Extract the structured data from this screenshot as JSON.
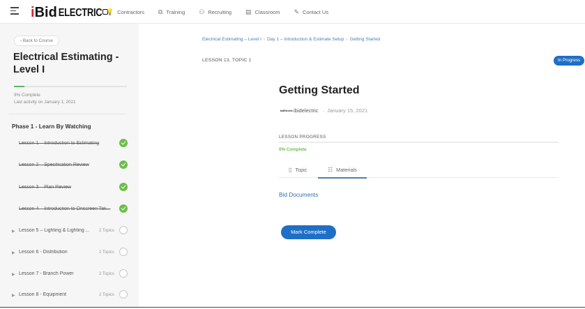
{
  "header": {
    "logo_word": "Bid",
    "logo_accent": "ELECTRIC",
    "nav": [
      {
        "label": "Contractors",
        "icon": "lightbulb-icon",
        "glyph": "💡"
      },
      {
        "label": "Training",
        "icon": "training-icon",
        "glyph": "⧉"
      },
      {
        "label": "Recruiting",
        "icon": "recruiting-icon",
        "glyph": "⚇"
      },
      {
        "label": "Classroom",
        "icon": "classroom-icon",
        "glyph": "▤"
      },
      {
        "label": "Contact Us",
        "icon": "edit-icon",
        "glyph": "✎"
      }
    ]
  },
  "sidebar": {
    "back_label": "‹  Back to Course",
    "course_title": "Electrical Estimating - Level I",
    "progress_pct": 0.09,
    "complete_text": "9% Complete",
    "activity_text": "Last activity on January 1, 2021",
    "phase_title": "Phase 1 - Learn By Watching",
    "lessons": [
      {
        "title": "Lesson 1 – Introduction to Estimating",
        "topics": "",
        "done": true
      },
      {
        "title": "Lesson 2 – Specification Review",
        "topics": "",
        "done": true
      },
      {
        "title": "Lesson 3 – Plan Review",
        "topics": "",
        "done": true
      },
      {
        "title": "Lesson 4 – Introduction to Onscreen Tak...",
        "topics": "",
        "done": true
      },
      {
        "title": "Lesson 5 – Lighting & Lighting ...",
        "topics": "2 Topics",
        "done": false
      },
      {
        "title": "Lesson 6 - Distribution",
        "topics": "2 Topics",
        "done": false
      },
      {
        "title": "Lesson 7 - Branch Power",
        "topics": "2 Topics",
        "done": false
      },
      {
        "title": "Lesson 8 - Equipment",
        "topics": "2 Topics",
        "done": false
      }
    ]
  },
  "main": {
    "breadcrumb": [
      "Electrical Estimating – Level I",
      "Day 1 – Introduction & Estimate Setup",
      "Getting Started"
    ],
    "breadcrumb_sep": "›",
    "lesson_label": "LESSON 13, TOPIC 1",
    "status": "In Progress",
    "title": "Getting Started",
    "author_avatar_text": "bidElectric",
    "author": "ibidelectric",
    "date": "January 15, 2021",
    "lesson_progress_label": "LESSON PROGRESS",
    "lesson_progress_pct": 0,
    "lesson_progress_text": "0% Complete",
    "tabs": {
      "topic": "Topic",
      "materials": "Materials"
    },
    "bid_link": "Bid Documents",
    "mark_complete": "Mark Complete"
  },
  "colors": {
    "accent": "#1f6fc6",
    "success": "#6cbf4a",
    "link": "#2f6fb3",
    "brand_red": "#d8232a"
  }
}
